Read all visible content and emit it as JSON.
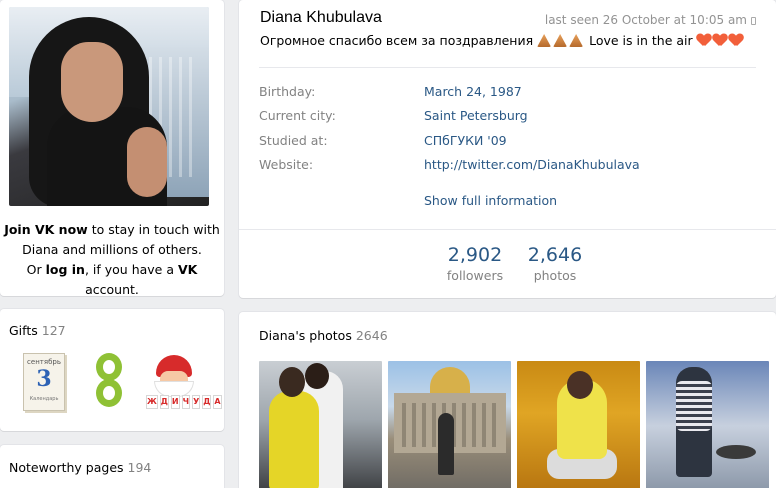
{
  "left": {
    "join": {
      "join_link": "Join VK now",
      "line1_rest": " to stay in touch with",
      "line2": "Diana and millions of others.",
      "line3_pre": "Or ",
      "login_link": "log in",
      "line3_mid": ", if you have a ",
      "vk": "VK",
      "line3_end": " account."
    },
    "gifts": {
      "title": "Gifts",
      "count": "127",
      "items": [
        {
          "icon": "calendar-gift-icon",
          "month": "сентябрь",
          "day": "3",
          "sub": "Календарь"
        },
        {
          "icon": "figure-eight-gift-icon"
        },
        {
          "icon": "santa-gift-icon",
          "letters": [
            "Ж",
            "Д",
            "И",
            "Ч",
            "У",
            "Д",
            "А"
          ]
        }
      ]
    },
    "noteworthy": {
      "title": "Noteworthy pages",
      "count": "194"
    }
  },
  "profile": {
    "name": "Diana Khubulava",
    "last_seen": "last seen 26 October at 10:05 am",
    "status_text": "Огромное спасибо всем за поздравления",
    "status_tail": "Love is in the air",
    "rows": [
      {
        "label": "Birthday:",
        "value": "March 24, 1987"
      },
      {
        "label": "Current city:",
        "value": "Saint Petersburg"
      },
      {
        "label": "Studied at:",
        "value": "СПбГУКИ '09"
      },
      {
        "label": "Website:",
        "value": "http://twitter.com/DianaKhubulava"
      }
    ],
    "show_full": "Show full information",
    "stats": [
      {
        "number": "2,902",
        "label": "followers"
      },
      {
        "number": "2,646",
        "label": "photos"
      }
    ]
  },
  "photos": {
    "title": "Diana's photos",
    "count": "2646"
  },
  "colors": {
    "link": "#2a5885",
    "muted": "#828282",
    "page_bg": "#edeef0"
  }
}
